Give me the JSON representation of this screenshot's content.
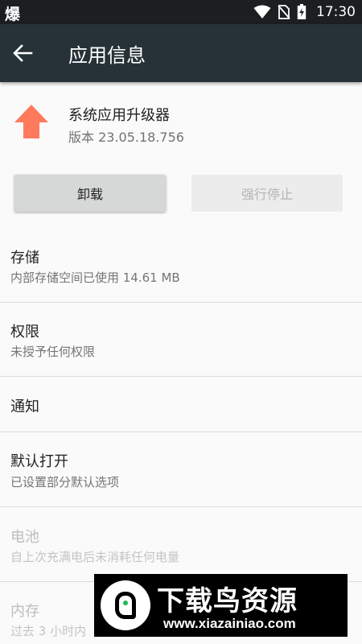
{
  "statusbar": {
    "left_glyph": "爆",
    "time": "17:30",
    "icons": [
      "wifi-icon",
      "no-sim-icon",
      "battery-charging-icon"
    ]
  },
  "appbar": {
    "title": "应用信息",
    "back_icon": "arrow-left-icon"
  },
  "app": {
    "name": "系统应用升级器",
    "version": "版本 23.05.18.756",
    "icon": "orange-up-arrow-icon",
    "icon_color": "#ff7a5c"
  },
  "actions": {
    "uninstall": "卸载",
    "force_stop": "强行停止"
  },
  "sections": [
    {
      "title": "存储",
      "subtitle": "内部存储空间已使用 14.61 MB"
    },
    {
      "title": "权限",
      "subtitle": "未授予任何权限"
    },
    {
      "title": "通知",
      "subtitle": ""
    },
    {
      "title": "默认打开",
      "subtitle": "已设置部分默认选项"
    },
    {
      "title": "电池",
      "subtitle": "自上次充满电后未消耗任何电量"
    },
    {
      "title": "内存",
      "subtitle": "过去 3 小时内"
    }
  ],
  "watermark": {
    "brand": "下载鸟资源",
    "url": "www.xiazainiao.com"
  },
  "colors": {
    "appbar": "#263238",
    "statusbar": "#1b1f22",
    "background": "#fafafa"
  }
}
